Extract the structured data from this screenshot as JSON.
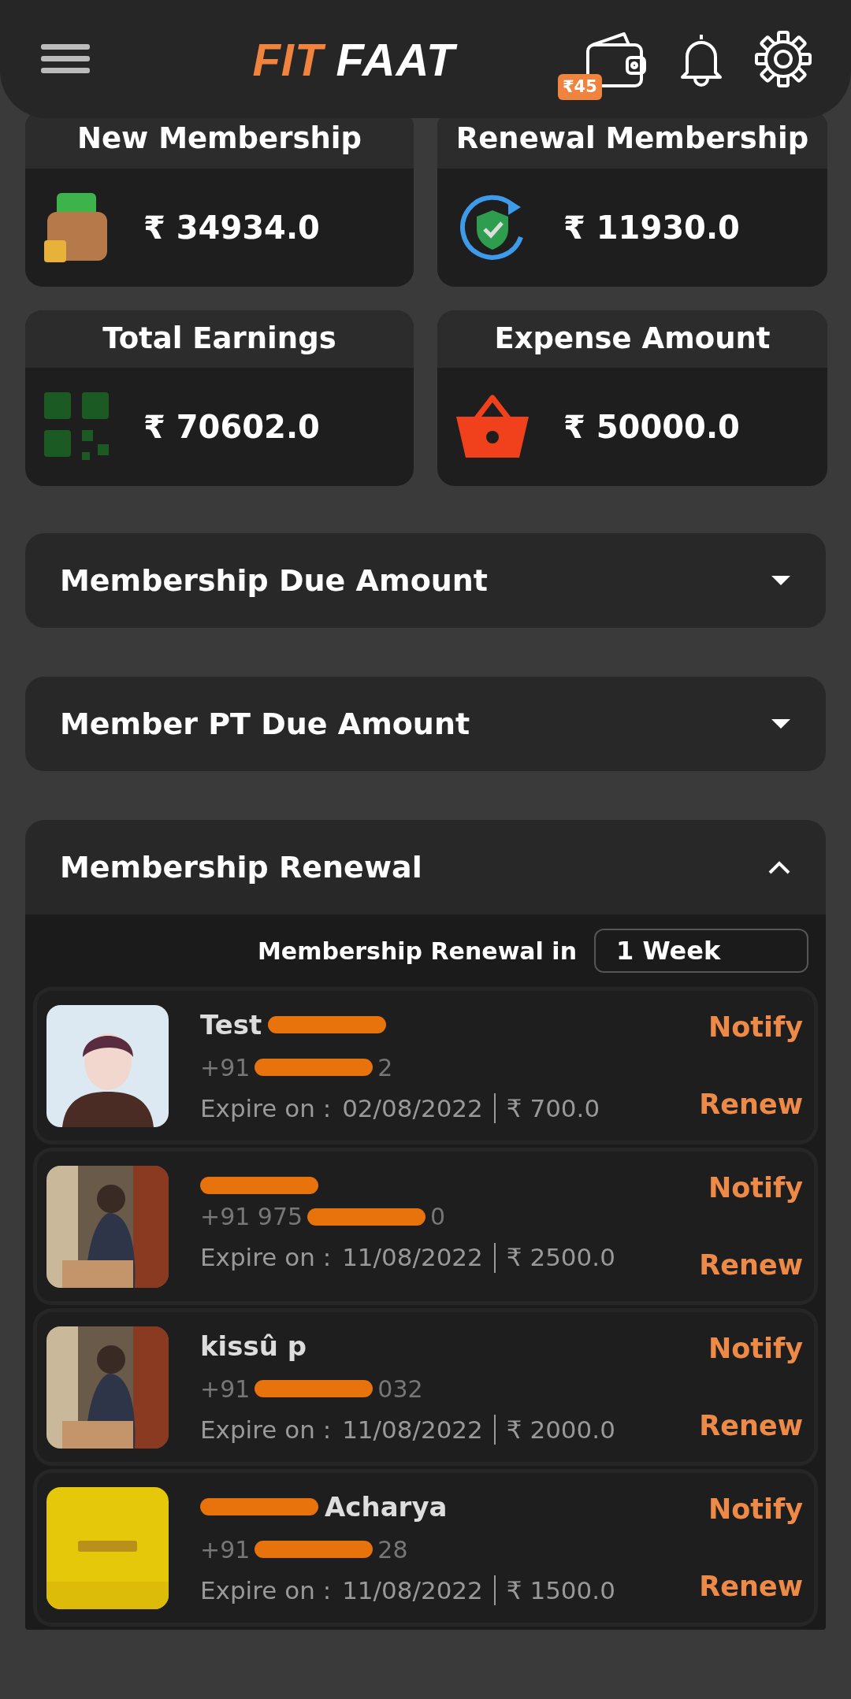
{
  "header": {
    "logo": [
      {
        "text": "FIT",
        "kind": "accent"
      },
      {
        "text": "FAAT",
        "kind": "plain"
      }
    ],
    "wallet_badge": "₹45"
  },
  "stats": [
    {
      "title": "New Membership",
      "amount": "₹ 34934.0",
      "kind": "wallet"
    },
    {
      "title": "Renewal Membership",
      "amount": "₹ 11930.0",
      "kind": "shield"
    },
    {
      "title": "Total Earnings",
      "amount": "₹ 70602.0",
      "kind": "qr"
    },
    {
      "title": "Expense Amount",
      "amount": "₹ 50000.0",
      "kind": "basket"
    }
  ],
  "sections": [
    {
      "title": "Membership Due Amount",
      "expanded": false
    },
    {
      "title": "Member PT Due Amount",
      "expanded": false
    },
    {
      "title": "Membership Renewal",
      "expanded": true
    }
  ],
  "renewal": {
    "filter_label": "Membership Renewal in",
    "period": "1 Week",
    "members": [
      {
        "avatar": {
          "kind": "picture"
        },
        "name": [
          {
            "kind": "text",
            "text": "Test"
          },
          {
            "kind": "redacted"
          }
        ],
        "phone": [
          {
            "kind": "text",
            "text": "+91"
          },
          {
            "kind": "redacted"
          },
          {
            "kind": "text",
            "text": "2"
          }
        ],
        "expire_label": "Expire on :",
        "expire": "02/08/2022",
        "amount": "₹ 700.0",
        "notify": "Notify",
        "renew": "Renew"
      },
      {
        "avatar": {
          "kind": "picture"
        },
        "name": [
          {
            "kind": "redacted"
          }
        ],
        "phone": [
          {
            "kind": "text",
            "text": "+91 975"
          },
          {
            "kind": "redacted"
          },
          {
            "kind": "text",
            "text": "0"
          }
        ],
        "expire_label": "Expire on :",
        "expire": "11/08/2022",
        "amount": "₹ 2500.0",
        "notify": "Notify",
        "renew": "Renew"
      },
      {
        "avatar": {
          "kind": "picture"
        },
        "name": [
          {
            "kind": "text",
            "text": "kissû p"
          }
        ],
        "phone": [
          {
            "kind": "text",
            "text": "+91"
          },
          {
            "kind": "redacted"
          },
          {
            "kind": "text",
            "text": "032"
          }
        ],
        "expire_label": "Expire on :",
        "expire": "11/08/2022",
        "amount": "₹ 2000.0",
        "notify": "Notify",
        "renew": "Renew"
      },
      {
        "avatar": {
          "kind": "picture"
        },
        "name": [
          {
            "kind": "redacted"
          },
          {
            "kind": "text",
            "text": "Acharya"
          }
        ],
        "phone": [
          {
            "kind": "text",
            "text": "+91"
          },
          {
            "kind": "redacted"
          },
          {
            "kind": "text",
            "text": "28"
          }
        ],
        "expire_label": "Expire on :",
        "expire": "11/08/2022",
        "amount": "₹ 1500.0",
        "notify": "Notify",
        "renew": "Renew"
      }
    ]
  }
}
